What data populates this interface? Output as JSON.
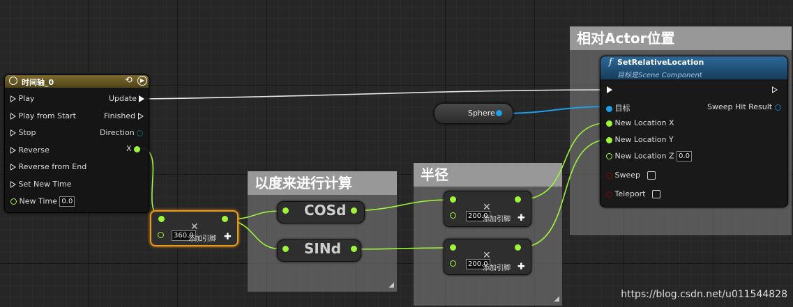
{
  "timeline": {
    "title": "时间轴_0",
    "inputs": [
      "Play",
      "Play from Start",
      "Stop",
      "Reverse",
      "Reverse from End",
      "Set New Time"
    ],
    "new_time_label": "New Time",
    "new_time_value": "0.0",
    "outputs": [
      "Update",
      "Finished",
      "Direction",
      "X"
    ]
  },
  "multiply_node": {
    "value": "360.0",
    "add_pin": "添加引脚"
  },
  "comments": {
    "degrees": "以度来进行计算",
    "radius": "半径",
    "relative": "相对Actor位置"
  },
  "cos_node": {
    "label": "COSd"
  },
  "sin_node": {
    "label": "SINd"
  },
  "radius_nodes": [
    {
      "value": "200.0",
      "add_pin": "添加引脚"
    },
    {
      "value": "200.0",
      "add_pin": "添加引脚"
    }
  ],
  "sphere_var": {
    "label": "Sphere"
  },
  "set_location": {
    "function_icon": "f",
    "title": "SetRelativeLocation",
    "subtitle": "目标是Scene Component",
    "target_label": "目标",
    "sweep_result_label": "Sweep Hit Result",
    "loc_x": "New Location X",
    "loc_y": "New Location Y",
    "loc_z": "New Location Z",
    "loc_z_value": "0.0",
    "sweep": "Sweep",
    "teleport": "Teleport"
  },
  "watermark": "https://blog.csdn.net/u011544828",
  "colors": {
    "float_pin": "#9ef539",
    "object_pin": "#1e9fe8",
    "bool_pin": "#8c0000",
    "struct_pin": "#1a6fb0",
    "timeline_header": "#6b5a25",
    "function_header": "#1e4e73",
    "selection": "#e89a1b",
    "exec_wire": "#e6e6e6"
  },
  "icons": [
    "clock-icon",
    "loop-icon",
    "play-icon",
    "function-icon",
    "remove-pin-icon",
    "add-pin-icon",
    "checkbox"
  ]
}
